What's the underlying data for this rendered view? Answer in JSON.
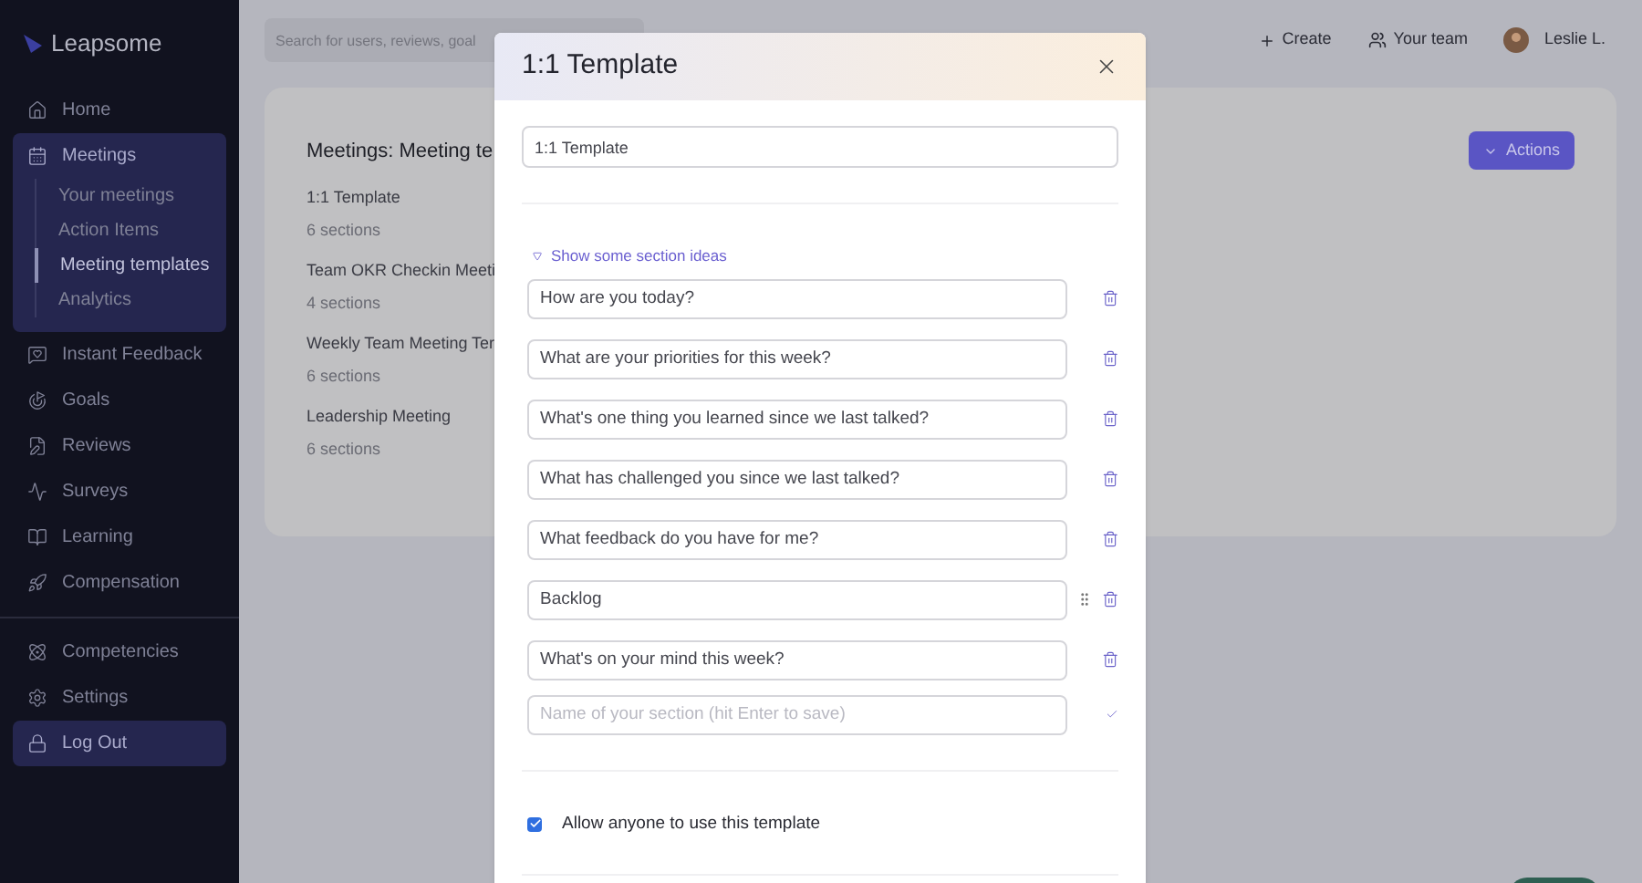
{
  "sidebar": {
    "logo": "Leapsome",
    "items": [
      {
        "label": "Home",
        "selected": false
      },
      {
        "label": "Meetings",
        "selected": true,
        "expanded": true,
        "children": [
          {
            "label": "Your meetings",
            "selected": false
          },
          {
            "label": "Action Items",
            "selected": false
          },
          {
            "label": "Meeting templates",
            "selected": true
          },
          {
            "label": "Analytics",
            "selected": false
          }
        ]
      },
      {
        "label": "Instant Feedback",
        "selected": false
      },
      {
        "label": "Goals",
        "selected": false
      },
      {
        "label": "Reviews",
        "selected": false
      },
      {
        "label": "Surveys",
        "selected": false
      },
      {
        "label": "Learning",
        "selected": false
      },
      {
        "label": "Compensation",
        "selected": false
      }
    ],
    "bottom_items": [
      {
        "label": "Competencies",
        "selected": false
      },
      {
        "label": "Settings",
        "selected": false
      },
      {
        "label": "Log Out",
        "selected": true
      }
    ]
  },
  "topbar": {
    "search": {
      "placeholder": "Search for users, reviews, goal"
    },
    "create": "Create",
    "team": "Your team",
    "user": "Leslie L."
  },
  "card": {
    "title": "Meetings: Meeting te",
    "actions": "Actions",
    "templates": [
      {
        "name": "1:1 Template",
        "sections": "6 sections"
      },
      {
        "name": "Team OKR Checkin Meeti",
        "sections": "4 sections"
      },
      {
        "name": "Weekly Team Meeting Ter",
        "sections": "6 sections"
      },
      {
        "name": "Leadership Meeting",
        "sections": "6 sections"
      }
    ]
  },
  "modal": {
    "title": "1:1 Template",
    "name_value": "1:1 Template",
    "ideas_toggle": "Show some section ideas",
    "sections": [
      {
        "value": "How are you today?",
        "drag_handle": false
      },
      {
        "value": "What are your priorities for this week?",
        "drag_handle": false
      },
      {
        "value": "What's one thing you learned since we last talked?",
        "drag_handle": false
      },
      {
        "value": "What has challenged you since we last talked?",
        "drag_handle": false
      },
      {
        "value": "What feedback do you have for me?",
        "drag_handle": false
      },
      {
        "value": "Backlog",
        "drag_handle": true
      },
      {
        "value": "What's on your mind this week?",
        "drag_handle": false
      }
    ],
    "new_section": {
      "placeholder": "Name of your section (hit Enter to save)"
    },
    "allow_anyone": {
      "label": "Allow anyone to use this template",
      "checked": true
    }
  }
}
